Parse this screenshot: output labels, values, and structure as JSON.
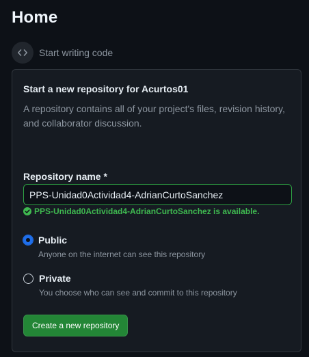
{
  "page": {
    "title": "Home"
  },
  "timeline": {
    "icon": "code-icon",
    "label": "Start writing code"
  },
  "new_repo": {
    "title": "Start a new repository for Acurtos01",
    "description": "A repository contains all of your project's files, revision history, and collaborator discussion.",
    "name_label": "Repository name *",
    "name_value": "PPS-Unidad0Actividad4-AdrianCurtoSanchez",
    "validation_message": "PPS-Unidad0Actividad4-AdrianCurtoSanchez is available.",
    "visibility": {
      "selected": "public",
      "public": {
        "label": "Public",
        "description": "Anyone on the internet can see this repository"
      },
      "private": {
        "label": "Private",
        "description": "You choose who can see and commit to this repository"
      }
    },
    "create_button": "Create a new repository"
  },
  "colors": {
    "background": "#0d1117",
    "card": "#161b22",
    "success": "#3fb950",
    "button": "#238636",
    "accent": "#1f6feb"
  }
}
